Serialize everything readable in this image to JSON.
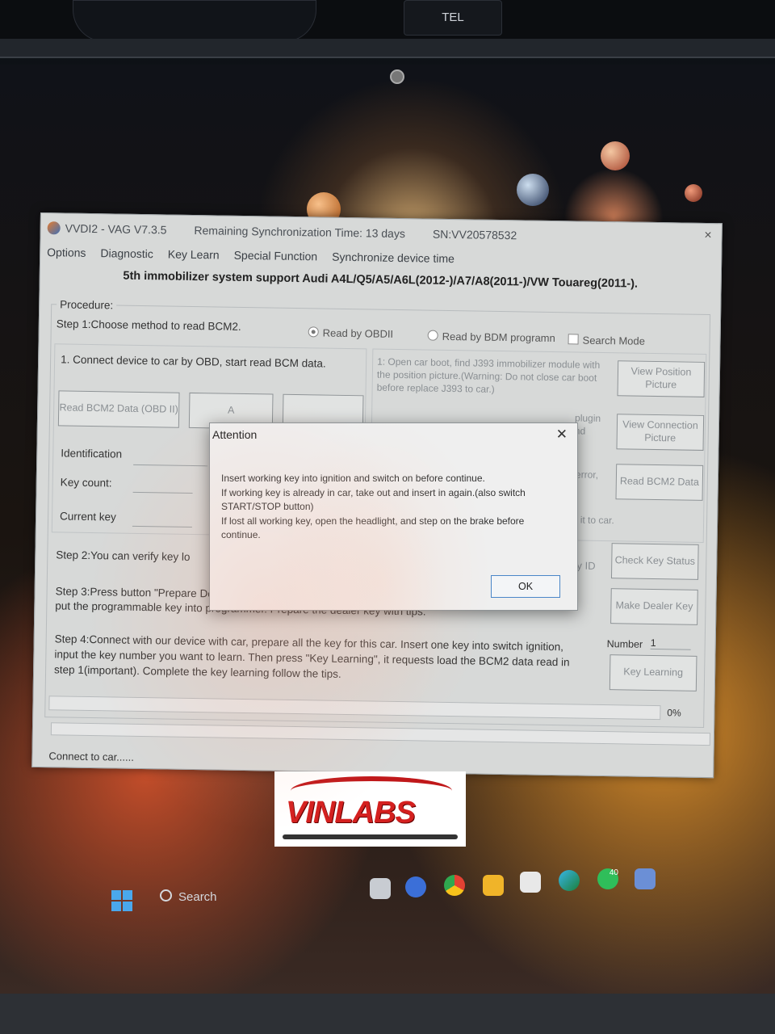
{
  "window": {
    "title": "VVDI2 - VAG V7.3.5",
    "sync": "Remaining Synchronization Time: 13 days",
    "serial": "SN:VV20578532",
    "close": "×"
  },
  "menu": [
    "Options",
    "Diagnostic",
    "Key Learn",
    "Special Function",
    "Synchronize device time"
  ],
  "banner": "5th immobilizer system support Audi A4L/Q5/A5/A6L(2012-)/A7/A8(2011-)/VW Touareg(2011-).",
  "procedure": {
    "label": "Procedure:",
    "step1": "Step 1:Choose method to read BCM2.",
    "radio_obd": "Read by OBDII",
    "radio_bdm": "Read by BDM programn",
    "search_mode": "Search Mode",
    "obd_instruction": "1. Connect device to car by OBD, start read BCM data.",
    "btn_read_obd": "Read BCM2 Data (OBD II)",
    "btn_mid_a": "A",
    "btn_mid_b": "",
    "identification": "Identification",
    "key_count": "Key count:",
    "current_key": "Current key",
    "bdm_instruction": "1: Open car boot, find J393 immobilizer module with the position picture.(Warning: Do not close car boot before replace J393 to car.)",
    "btn_view_position": "View Position Picture",
    "partial_plugin": "plugin",
    "partial_nd": "nd",
    "btn_view_connection": "View Connection Picture",
    "partial_error": "error,",
    "btn_read_bcm2": "Read BCM2 Data",
    "partial_car": "t it to car.",
    "step2": "Step 2:You can verify key lo",
    "partial_keyid": "ey ID",
    "btn_check_key": "Check Key Status",
    "step3": "Step 3:Press button \"Prepare Dealer Key\", it requests load the BCM2 data read in step 1(important). Then put the programmable key into programmer. Prepare the dealer key with tips.",
    "btn_make_dealer": "Make Dealer Key",
    "step4": "Step 4:Connect with our device with car, prepare all the key for this car. Insert one key into switch ignition, input the key number you want to learn. Then press \"Key Learning\", it requests load the BCM2 data read in step 1(important). Complete the key learning follow the tips.",
    "number_label": "Number",
    "number_value": "1",
    "btn_key_learning": "Key Learning",
    "progress_percent": "0%",
    "progress_value": 0
  },
  "status": "Connect to car......",
  "dialog": {
    "title": "Attention",
    "close": "✕",
    "line1": "Insert working key into ignition and switch on before continue.",
    "line2": "If working key is already in car, take out and insert in again.(also switch START/STOP button)",
    "line3": "If lost all working key, open the headlight, and step on the brake before continue.",
    "ok": "OK"
  },
  "watermark": "VINLABS",
  "car": {
    "tel_button": "TEL"
  },
  "taskbar": {
    "search": "Search",
    "badge": "40"
  }
}
